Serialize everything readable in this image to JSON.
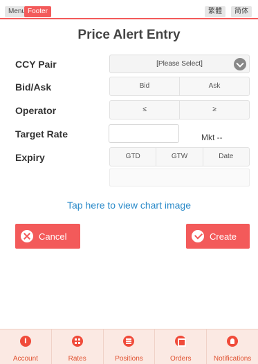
{
  "topbar": {
    "menu_label": "Menu",
    "footer_label": "Footer",
    "traditional_label": "繁體",
    "simplified_label": "简体"
  },
  "page": {
    "title": "Price Alert Entry"
  },
  "form": {
    "ccy_pair": {
      "label": "CCY Pair",
      "value": "[Please Select]"
    },
    "bid_ask": {
      "label": "Bid/Ask",
      "options": [
        "Bid",
        "Ask"
      ]
    },
    "operator": {
      "label": "Operator",
      "options": [
        "≤",
        "≥"
      ]
    },
    "target_rate": {
      "label": "Target Rate",
      "value": "",
      "mkt_label": "Mkt --"
    },
    "expiry": {
      "label": "Expiry",
      "options": [
        "GTD",
        "GTW",
        "Date"
      ],
      "date_value": ""
    }
  },
  "chart_link": "Tap here to view chart image",
  "actions": {
    "cancel_label": "Cancel",
    "create_label": "Create"
  },
  "footer_tabs": [
    {
      "label": "Account",
      "icon": "info-icon"
    },
    {
      "label": "Rates",
      "icon": "grid-icon"
    },
    {
      "label": "Positions",
      "icon": "list-icon"
    },
    {
      "label": "Orders",
      "icon": "orders-icon"
    },
    {
      "label": "Notifications",
      "icon": "notifications-icon"
    }
  ],
  "colors": {
    "accent": "#f35a5a",
    "link": "#2a8ac9",
    "footer_bg": "#fbe9e3"
  }
}
